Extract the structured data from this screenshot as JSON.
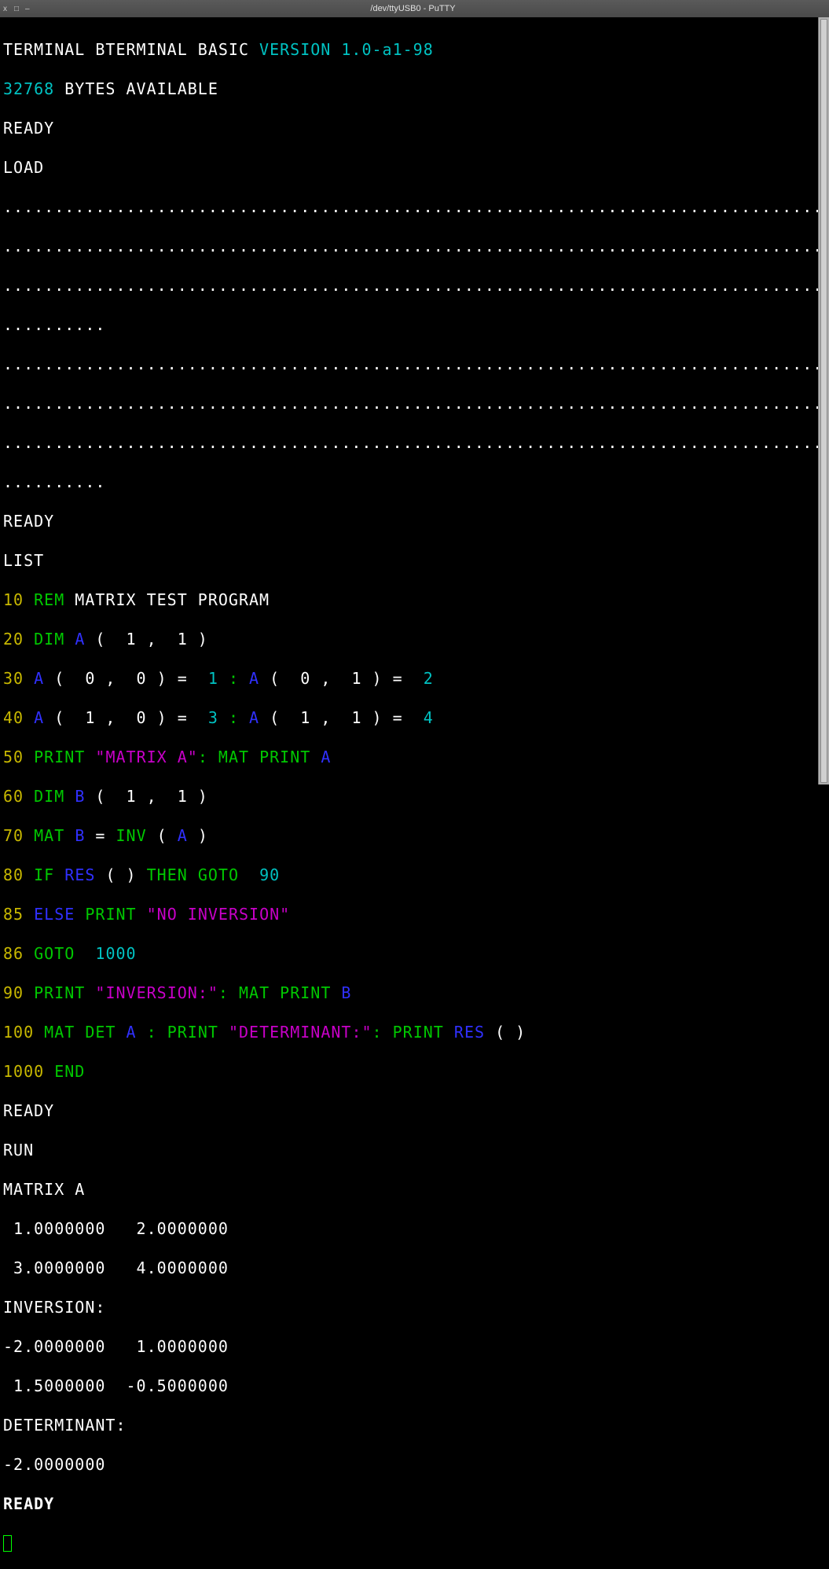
{
  "window": {
    "title": "/dev/ttyUSB0 - PuTTY",
    "controls": {
      "close": "x",
      "maximize": "□",
      "minimize": "–"
    }
  },
  "header": {
    "prefix": "TERMINAL BTERMINAL BASIC ",
    "version_label": "VERSION 1.0-a1-98",
    "mem_bytes": "32768",
    "mem_suffix": " BYTES AVAILABLE",
    "ready": "READY",
    "load": "LOAD"
  },
  "dots_row": "..................................................................................",
  "dots_row_short": "..........",
  "list_cmd": "LIST",
  "program": {
    "l10": {
      "num": "10",
      "kw": "REM",
      "rest": " MATRIX TEST PROGRAM"
    },
    "l20": {
      "num": "20",
      "kw": "DIM",
      "pre": " ",
      "var": "A",
      "post": " (  1 ,  1 )"
    },
    "l30": {
      "num": "30",
      "pre": " ",
      "a1": "A",
      "seg1": " (  0 ,  0 ) = ",
      "v1": " 1 ",
      "colon1": ":",
      "sp1": " ",
      "a2": "A",
      "seg2": " (  0 ,  1 ) = ",
      "v2": " 2"
    },
    "l40": {
      "num": "40",
      "pre": " ",
      "a1": "A",
      "seg1": " (  1 ,  0 ) = ",
      "v1": " 3 ",
      "colon1": ":",
      "sp1": " ",
      "a2": "A",
      "seg2": " (  1 ,  1 ) = ",
      "v2": " 4"
    },
    "l50": {
      "num": "50",
      "kw1": "PRINT",
      "sp1": " ",
      "str": "\"MATRIX A\"",
      "colon": ":",
      "sp2": " ",
      "kw2": "MAT PRINT",
      "sp3": " ",
      "var": "A"
    },
    "l60": {
      "num": "60",
      "kw": "DIM",
      "pre": " ",
      "var": "B",
      "post": " (  1 ,  1 )"
    },
    "l70": {
      "num": "70",
      "kw": "MAT",
      "sp1": " ",
      "var1": "B",
      "eq": " = ",
      "fn": "INV",
      "sp2": " ( ",
      "var2": "A",
      "close": " )"
    },
    "l80": {
      "num": "80",
      "kw1": "IF",
      "sp1": " ",
      "res": "RES",
      "args": " ( ) ",
      "kw2": "THEN GOTO",
      "sp2": "  ",
      "target": "90"
    },
    "l85": {
      "num": "85",
      "kw1": "ELSE",
      "sp1": " ",
      "kw2": "PRINT",
      "sp2": " ",
      "str": "\"NO INVERSION\""
    },
    "l86": {
      "num": "86",
      "kw": "GOTO",
      "sp": "  ",
      "target": "1000"
    },
    "l90": {
      "num": "90",
      "kw1": "PRINT",
      "sp1": " ",
      "str": "\"INVERSION:\"",
      "colon": ":",
      "sp2": " ",
      "kw2": "MAT PRINT",
      "sp3": " ",
      "var": "B"
    },
    "l100": {
      "num": "100",
      "kw1": "MAT DET",
      "sp1": " ",
      "var": "A",
      "sp2": " ",
      "colon1": ":",
      "sp3": " ",
      "kw2": "PRINT",
      "sp4": " ",
      "str": "\"DETERMINANT:\"",
      "colon2": ":",
      "sp5": " ",
      "kw3": "PRINT",
      "sp6": " ",
      "res": "RES",
      "args": " ( )"
    },
    "l1000": {
      "num": "1000",
      "kw": "END"
    }
  },
  "run": {
    "ready_before": "READY",
    "cmd": "RUN",
    "hdr_a": "MATRIX A",
    "a_row1": " 1.0000000   2.0000000",
    "a_row2": " 3.0000000   4.0000000",
    "hdr_inv": "INVERSION:",
    "inv_row1": "-2.0000000   1.0000000",
    "inv_row2": " 1.5000000  -0.5000000",
    "hdr_det": "DETERMINANT:",
    "det_val": "-2.0000000",
    "ready_after": "READY"
  }
}
